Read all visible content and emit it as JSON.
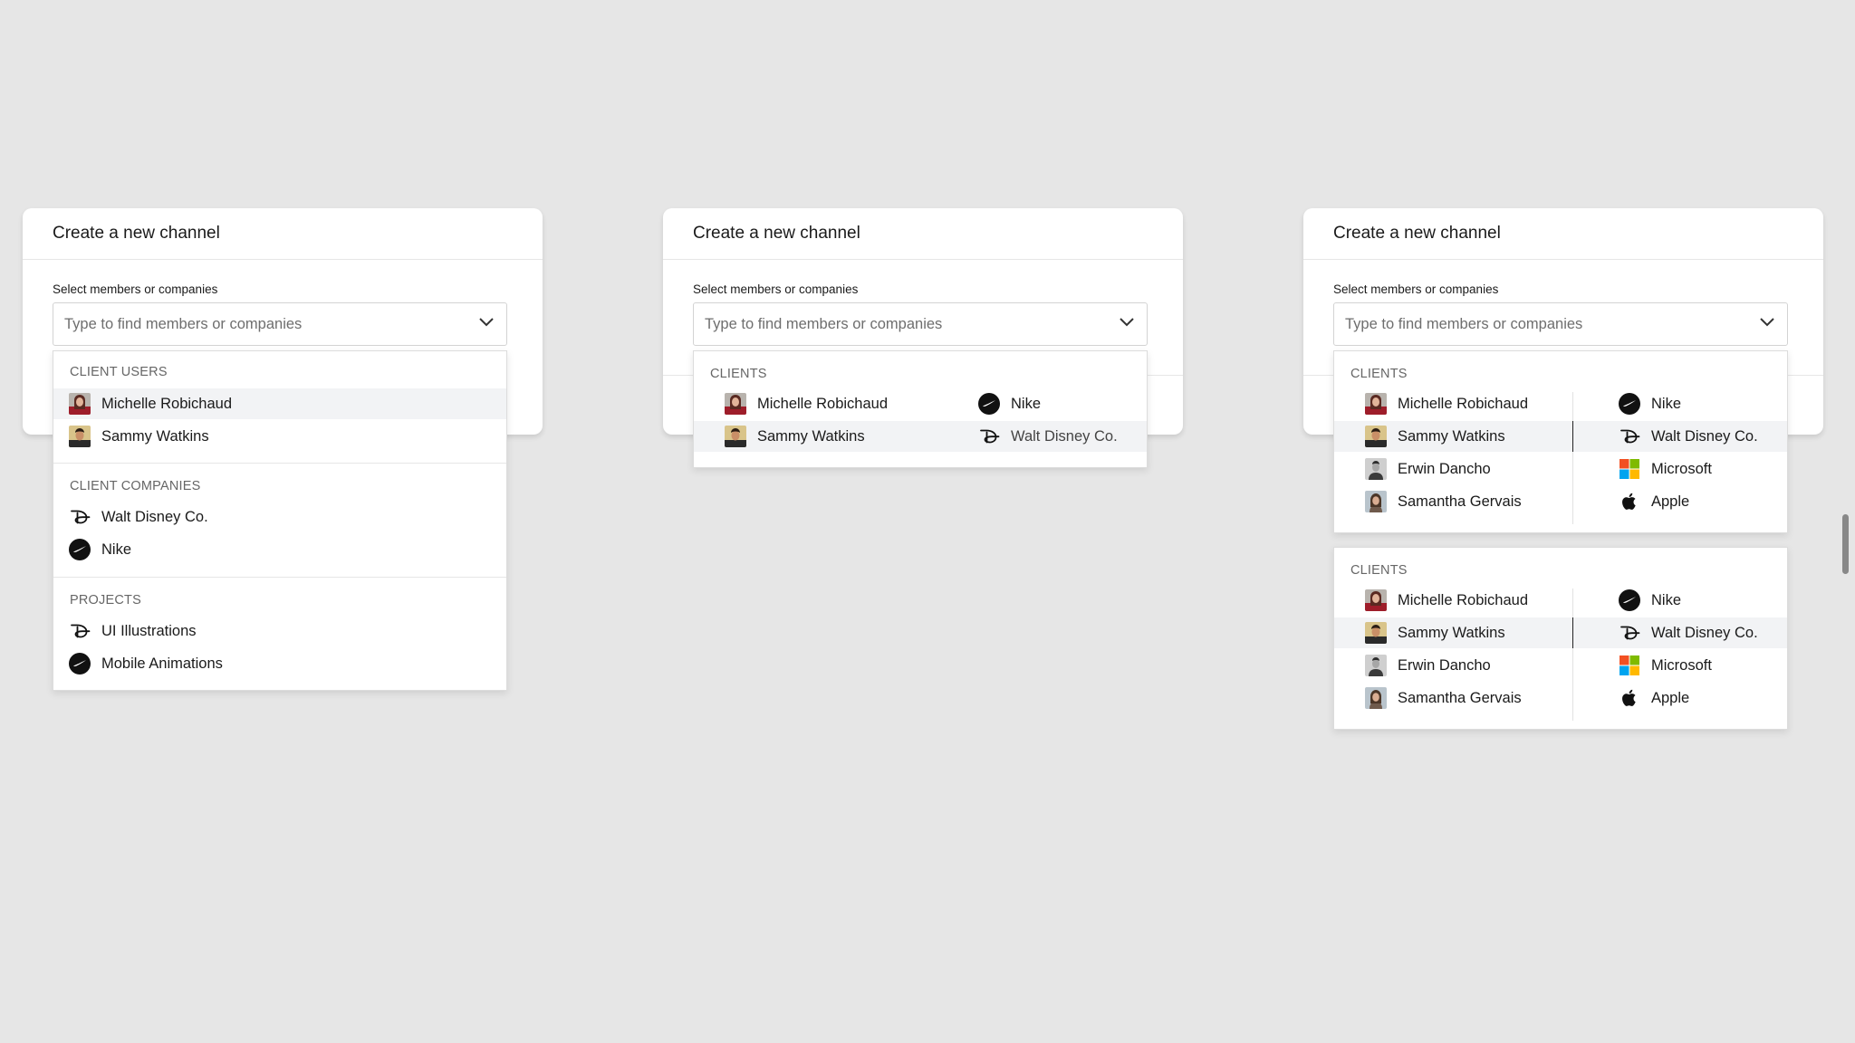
{
  "panels": [
    {
      "title": "Create a new channel",
      "field_label": "Select members or companies",
      "placeholder": "Type to find members or companies"
    },
    {
      "title": "Create a new channel",
      "field_label": "Select members or companies",
      "placeholder": "Type to find members or companies"
    },
    {
      "title": "Create a new channel",
      "field_label": "Select members or companies",
      "placeholder": "Type to find members or companies"
    }
  ],
  "dropdown1": {
    "sections": [
      {
        "title": "CLIENT USERS",
        "items": [
          {
            "label": "Michelle Robichaud",
            "icon": "avatar-michelle",
            "highlighted": true
          },
          {
            "label": "Sammy Watkins",
            "icon": "avatar-sammy",
            "highlighted": false
          }
        ]
      },
      {
        "title": "CLIENT COMPANIES",
        "items": [
          {
            "label": "Walt Disney Co.",
            "icon": "disney-logo-icon"
          },
          {
            "label": "Nike",
            "icon": "nike-logo-icon"
          }
        ]
      },
      {
        "title": "PROJECTS",
        "items": [
          {
            "label": "UI Illustrations",
            "icon": "disney-logo-icon"
          },
          {
            "label": "Mobile Animations",
            "icon": "nike-logo-icon"
          }
        ]
      }
    ]
  },
  "dropdown2": {
    "title": "CLIENTS",
    "rows": [
      {
        "left": "Michelle Robichaud",
        "right": "Nike"
      },
      {
        "left": "Sammy Watkins",
        "right": "Walt Disney Co."
      }
    ]
  },
  "dropdown3": {
    "title": "CLIENTS",
    "rows": [
      {
        "left": "Michelle Robichaud",
        "right": "Nike"
      },
      {
        "left": "Sammy Watkins",
        "right": "Walt Disney Co."
      },
      {
        "left": "Erwin Dancho",
        "right": "Microsoft"
      },
      {
        "left": "Samantha Gervais",
        "right": "Apple"
      }
    ]
  },
  "dropdown4": {
    "title": "CLIENTS",
    "rows": [
      {
        "left": "Michelle Robichaud",
        "right": "Nike"
      },
      {
        "left": "Sammy Watkins",
        "right": "Walt Disney Co."
      },
      {
        "left": "Erwin Dancho",
        "right": "Microsoft"
      },
      {
        "left": "Samantha Gervais",
        "right": "Apple"
      }
    ]
  },
  "colors": {
    "background": "#e6e6e6",
    "highlight_row": "#f2f3f5",
    "microsoft_red": "#f25022",
    "microsoft_green": "#7fba00",
    "microsoft_blue": "#00a4ef",
    "microsoft_yellow": "#ffb900"
  }
}
